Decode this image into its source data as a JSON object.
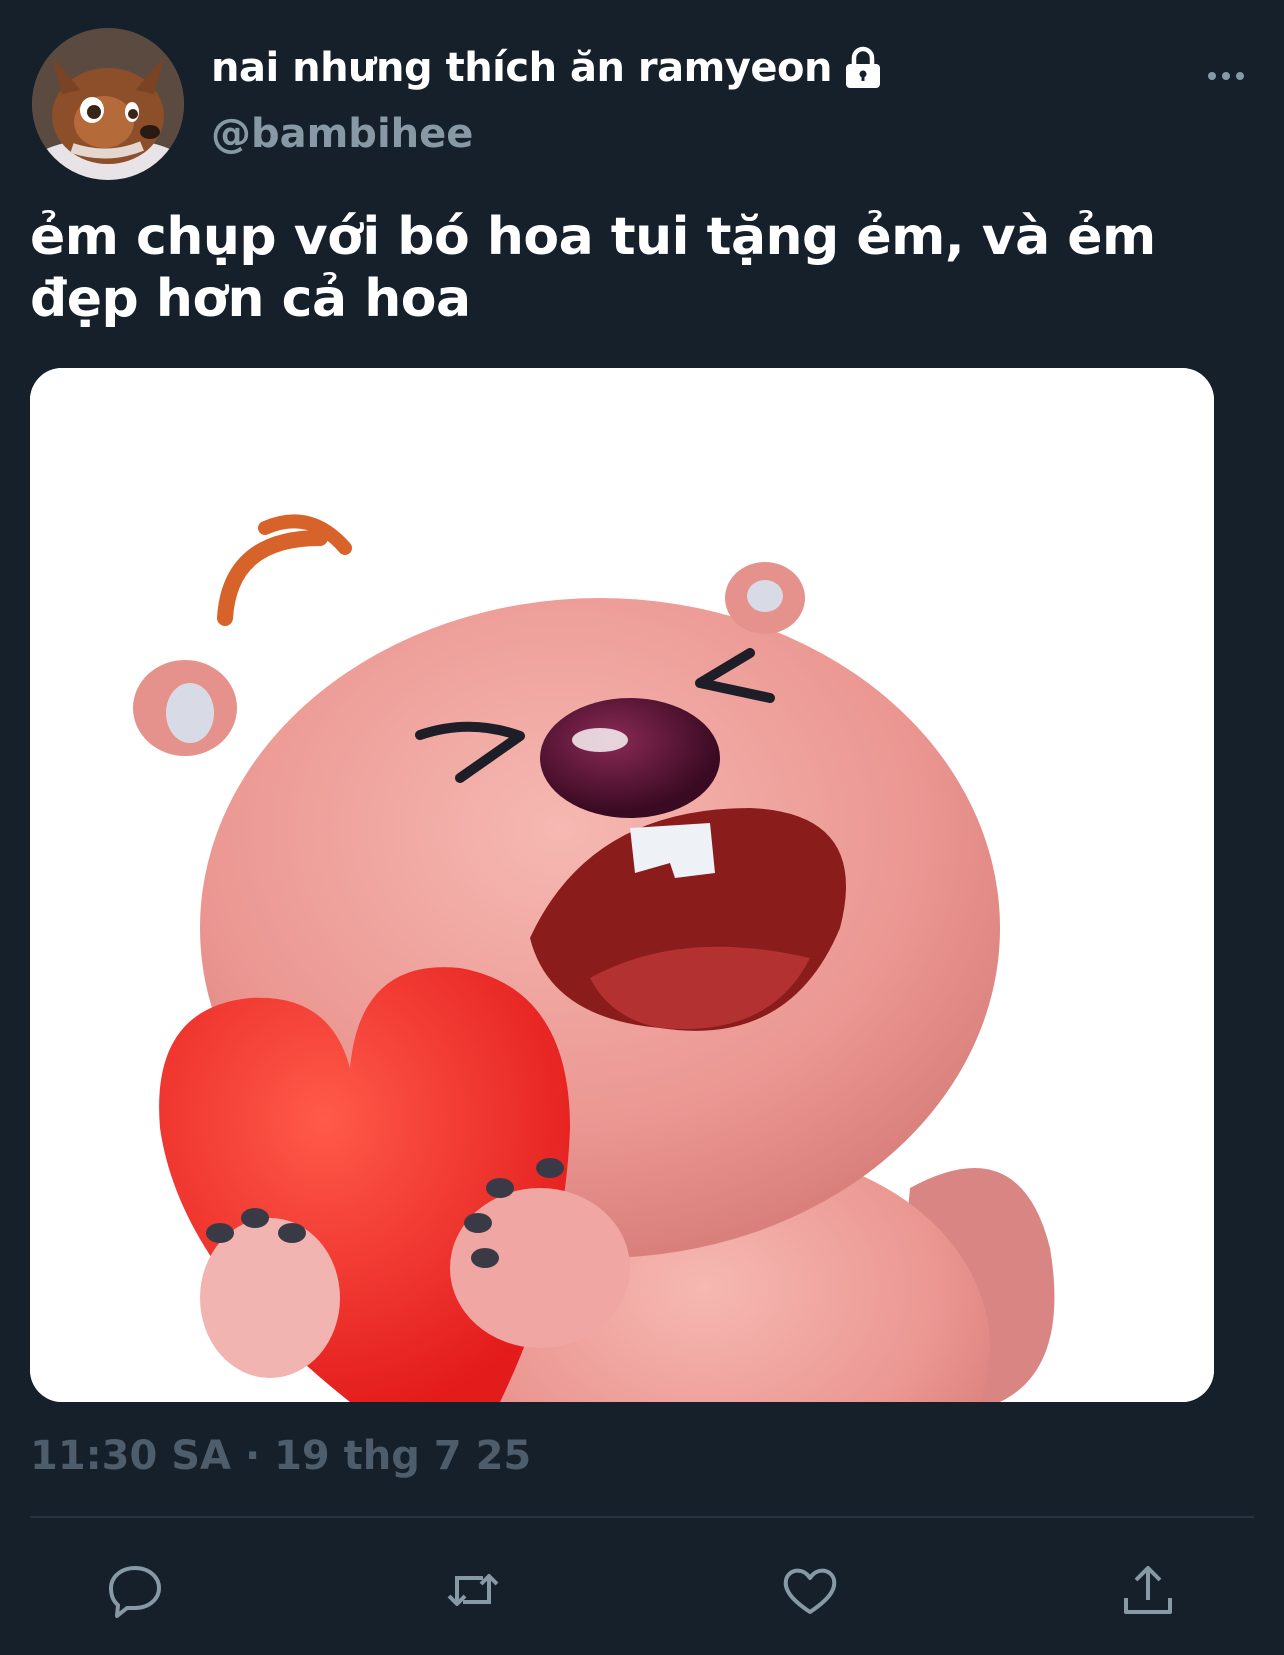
{
  "author": {
    "display_name": "nai nhưng thích ăn ramyeon",
    "handle": "@bambihee",
    "protected_icon": "lock-icon",
    "avatar_icon": "fawn-avatar"
  },
  "tweet": {
    "text": "ẻm chụp với bó hoa tui tặng ẻm, và ẻm đẹp hơn cả hoa",
    "media_icon": "pink-beaver-holding-heart-image",
    "timestamp": "11:30 SA · 19 thg 7 25"
  },
  "actions": [
    {
      "icon": "reply-icon"
    },
    {
      "icon": "retweet-icon"
    },
    {
      "icon": "like-icon"
    },
    {
      "icon": "share-icon"
    }
  ],
  "colors": {
    "background": "#15202b",
    "text": "#ffffff",
    "handle": "#8899a6",
    "timestamp": "#4e5d6b",
    "icon": "#8899a6",
    "divider": "#263340"
  }
}
